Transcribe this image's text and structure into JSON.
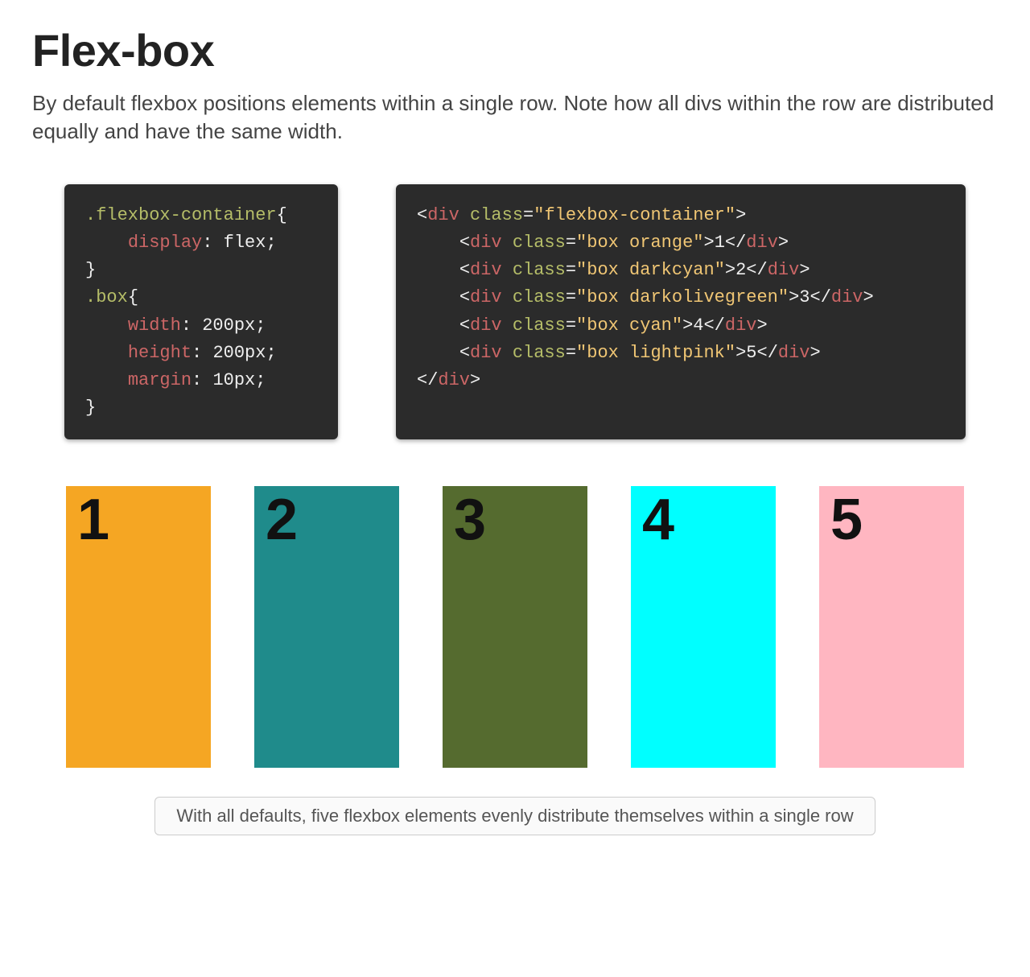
{
  "header": {
    "title": "Flex-box",
    "intro": "By default flexbox positions elements within a single row. Note how all divs within the row are distributed equally and have the same width."
  },
  "css": {
    "sel1": ".flexbox-container",
    "l1_prop": "display",
    "l1_val": "flex",
    "sel2": ".box",
    "l2_prop": "width",
    "l2_val": "200px",
    "l3_prop": "height",
    "l3_val": "200px",
    "l4_prop": "margin",
    "l4_val": "10px"
  },
  "html": {
    "tag_div": "div",
    "attr_class": "class",
    "outer_class": "flexbox-container",
    "rows": [
      {
        "cls": "box orange",
        "txt": "1"
      },
      {
        "cls": "box darkcyan",
        "txt": "2"
      },
      {
        "cls": "box darkolivegreen",
        "txt": "3"
      },
      {
        "cls": "box cyan",
        "txt": "4"
      },
      {
        "cls": "box lightpink",
        "txt": "5"
      }
    ]
  },
  "boxes": [
    {
      "label": "1",
      "color": "orange"
    },
    {
      "label": "2",
      "color": "darkcyan"
    },
    {
      "label": "3",
      "color": "darkolivegreen"
    },
    {
      "label": "4",
      "color": "cyan"
    },
    {
      "label": "5",
      "color": "lightpink"
    }
  ],
  "caption": "With all defaults, five flexbox elements evenly distribute themselves within a single row"
}
